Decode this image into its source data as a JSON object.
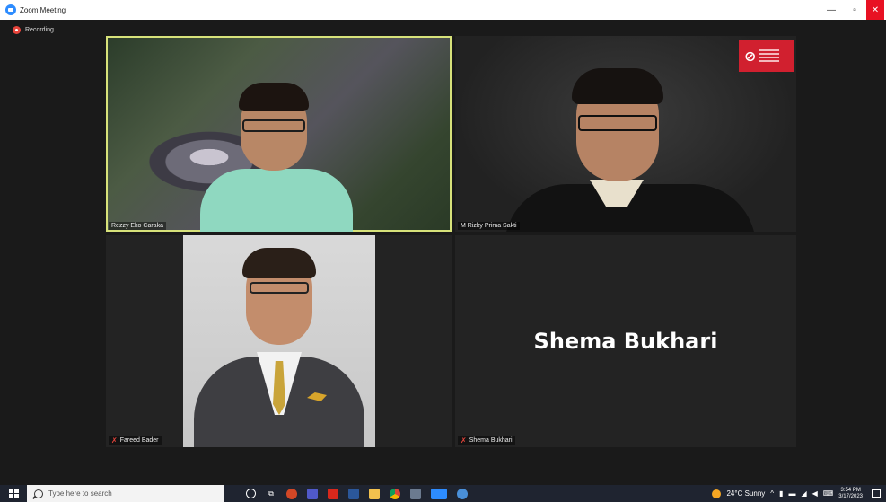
{
  "window": {
    "title": "Zoom Meeting"
  },
  "recording": {
    "label": "Recording"
  },
  "participants": [
    {
      "name": "Rezzy Eko Caraka",
      "muted": false,
      "active_speaker": true
    },
    {
      "name": "M Rizky Prima Sakti",
      "muted": false,
      "active_speaker": false
    },
    {
      "name": "Fareed Bader",
      "muted": true,
      "active_speaker": false
    },
    {
      "name": "Shema Bukhari",
      "muted": true,
      "active_speaker": false,
      "video_off_display": "Shema Bukhari"
    }
  ],
  "taskbar": {
    "search_placeholder": "Type here to search",
    "weather": "24°C  Sunny",
    "time": "3:54 PM",
    "date": "3/17/2023"
  },
  "colors": {
    "active_speaker_border": "#d7e27a",
    "close_button": "#e81123",
    "recording_dot": "#e8453c",
    "brand_logo": "#d1202f"
  }
}
